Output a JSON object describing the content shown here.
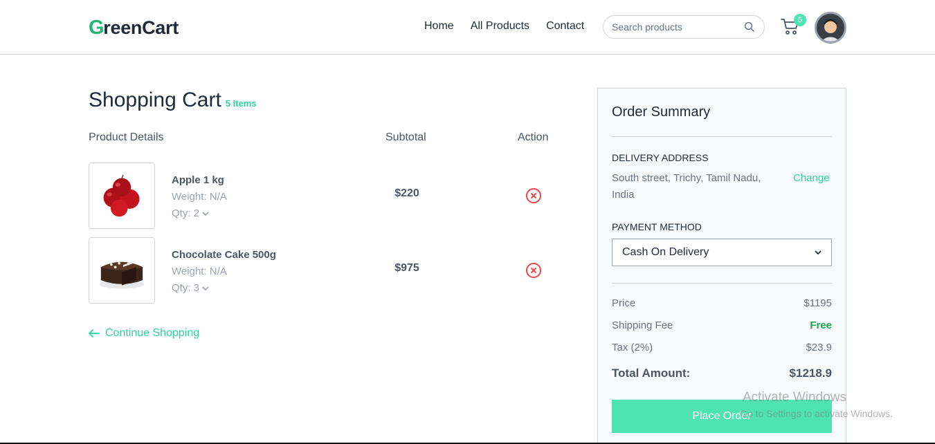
{
  "brand": {
    "logo_mark": "G",
    "logo_text": "reenCart",
    "accent": "#4fe3b2",
    "text_accent": "#2bd49c"
  },
  "nav": {
    "items": [
      "Home",
      "All Products",
      "Contact"
    ]
  },
  "search": {
    "placeholder": "Search products",
    "icon": "search-icon"
  },
  "cart": {
    "badge_count": "5",
    "icon": "cart-icon"
  },
  "page": {
    "title": "Shopping Cart",
    "item_count": "5 Items",
    "columns": {
      "product": "Product Details",
      "subtotal": "Subtotal",
      "action": "Action"
    },
    "items": [
      {
        "name": "Apple 1 kg",
        "weight": "Weight: N/A",
        "qty": "Qty: 2",
        "subtotal": "$220"
      },
      {
        "name": "Chocolate Cake 500g",
        "weight": "Weight: N/A",
        "qty": "Qty: 3",
        "subtotal": "$975"
      }
    ],
    "continue_label": "Continue Shopping"
  },
  "summary": {
    "title": "Order Summary",
    "delivery_label": "DELIVERY ADDRESS",
    "address": "South street, Trichy, Tamil Nadu, India",
    "change_label": "Change",
    "payment_label": "PAYMENT METHOD",
    "payment_selected": "Cash On Delivery",
    "price_label": "Price",
    "price_value": "$1195",
    "shipping_label": "Shipping Fee",
    "shipping_value": "Free",
    "tax_label": "Tax (2%)",
    "tax_value": "$23.9",
    "total_label": "Total Amount:",
    "total_value": "$1218.9",
    "place_order_label": "Place Order"
  },
  "watermark": {
    "line1": "Activate Windows",
    "line2": "Go to Settings to activate Windows."
  }
}
